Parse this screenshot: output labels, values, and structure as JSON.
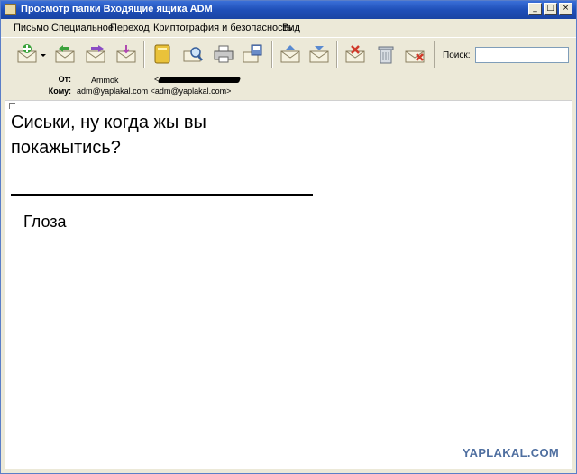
{
  "window": {
    "title": "Просмотр папки Входящие ящика ADM",
    "controls": {
      "minimize": "_",
      "maximize": "□",
      "close": "×"
    }
  },
  "menu": {
    "items": [
      {
        "label": "Письмо"
      },
      {
        "label": "Специальное"
      },
      {
        "label": "Переход"
      },
      {
        "label": "Криптография и безопасность"
      },
      {
        "label": "Вид"
      }
    ]
  },
  "toolbar": {
    "search_label": "Поиск:",
    "search_value": "",
    "buttons": [
      {
        "icon": "new-mail-icon"
      },
      {
        "icon": "dropdown-arrow-icon"
      },
      {
        "icon": "reply-all-icon"
      },
      {
        "icon": "forward-mail-icon"
      },
      {
        "icon": "redirect-mail-icon"
      },
      {
        "icon": "address-book-icon"
      },
      {
        "icon": "find-mail-icon"
      },
      {
        "icon": "print-icon"
      },
      {
        "icon": "save-icon"
      },
      {
        "icon": "previous-mail-icon"
      },
      {
        "icon": "next-mail-icon"
      },
      {
        "icon": "delete-mail-icon"
      },
      {
        "icon": "trash-icon"
      },
      {
        "icon": "spam-icon"
      }
    ]
  },
  "header": {
    "from_label": "От:",
    "from_name": "Ammok",
    "from_email_open": "<",
    "to_label": "Кому:",
    "to_value": "adm@yaplakal.com <adm@yaplakal.com>"
  },
  "message": {
    "body": "Сиськи, ну когда жы вы покажытись?",
    "signature": "Глоза"
  },
  "watermark": "YAPLAKAL.COM",
  "colors": {
    "titlebar": "#1f4fb8",
    "chrome": "#ece9d8",
    "watermark": "#4f6fa0"
  }
}
